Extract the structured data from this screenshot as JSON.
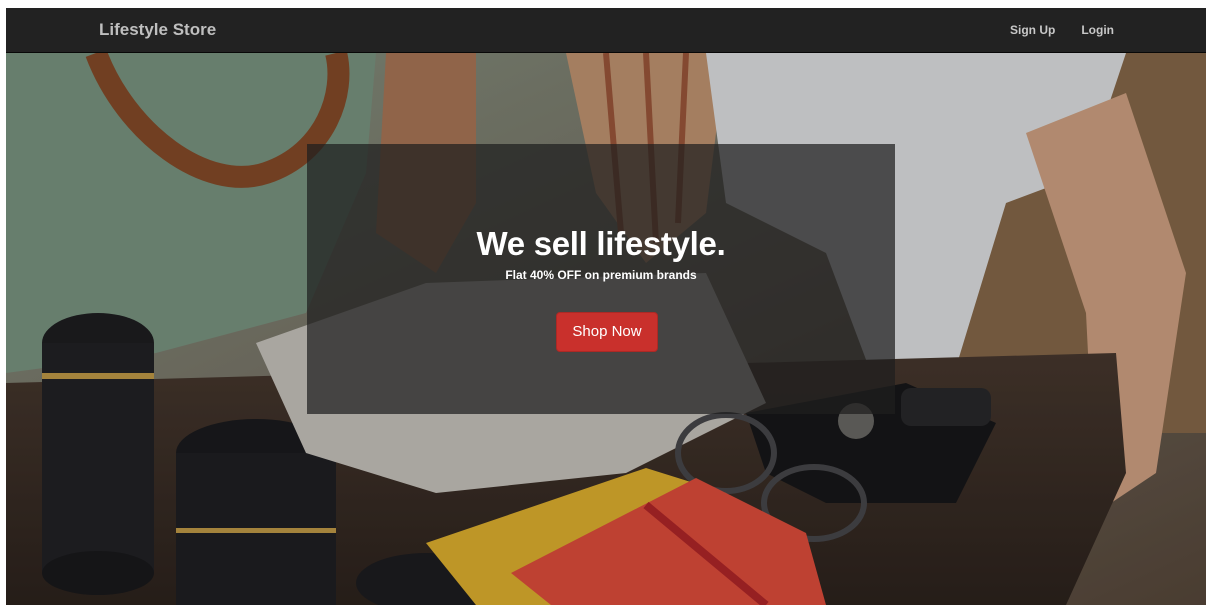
{
  "navbar": {
    "brand": "Lifestyle Store",
    "links": [
      {
        "label": "Sign Up"
      },
      {
        "label": "Login"
      }
    ]
  },
  "banner": {
    "heading": "We sell lifestyle.",
    "subtitle": "Flat 40% OFF on premium brands",
    "cta_label": "Shop Now"
  },
  "colors": {
    "navbar_bg": "#222222",
    "cta": "#c9302c"
  },
  "icons": {
    "hero_image": "lifestyle-table-photo"
  }
}
